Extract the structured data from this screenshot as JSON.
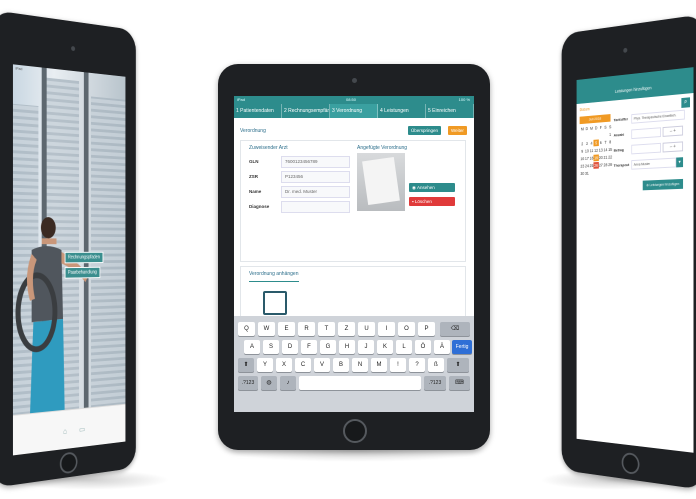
{
  "left_tablet": {
    "status_time": "iPad",
    "overlay_buttons": [
      "Rechnungspfaden",
      "Paarbehandlung"
    ]
  },
  "center_tablet": {
    "status": {
      "left": "iPad",
      "time": "08:50",
      "right": "100 %"
    },
    "steps": [
      {
        "label": "1 Patientendaten",
        "active": false
      },
      {
        "label": "2 Rechnungsempfänger",
        "active": false
      },
      {
        "label": "3 Verordnung",
        "active": true
      },
      {
        "label": "4 Leistungen",
        "active": false
      },
      {
        "label": "5 Einreichen",
        "active": false
      }
    ],
    "section_title": "Verordnung",
    "top_buttons": {
      "skip": "Überspringen",
      "next": "Weiter"
    },
    "card_title": "Zuweisender Arzt",
    "fields": [
      {
        "label": "GLN",
        "value": "7600123456789"
      },
      {
        "label": "ZSR",
        "value": "P123456"
      },
      {
        "label": "Name",
        "value": "Dr. med. Muster"
      },
      {
        "label": "Diagnose",
        "value": ""
      }
    ],
    "attachment_title": "Angefügte Verordnung",
    "view_button": "Ansehen",
    "delete_button": "Löschen",
    "attach_title": "Verordnung anhängen",
    "keyboard": {
      "row1": [
        "Q",
        "W",
        "E",
        "R",
        "T",
        "Z",
        "U",
        "I",
        "O",
        "P"
      ],
      "row2": [
        "A",
        "S",
        "D",
        "F",
        "G",
        "H",
        "J",
        "K",
        "L",
        "Ö",
        "Ä"
      ],
      "row3": [
        "Y",
        "X",
        "C",
        "V",
        "B",
        "N",
        "M",
        "!",
        "?",
        "ß"
      ],
      "row3_sub": [
        ",",
        "."
      ],
      "done": "Fertig",
      "num_left": ".?123",
      "num_right": ".?123"
    }
  },
  "right_tablet": {
    "header": "Leistungen hinzufügen",
    "sidebar_label": "Datum",
    "calendar_month": "Juli 2018",
    "weekdays": [
      "M",
      "D",
      "M",
      "D",
      "F",
      "S",
      "S"
    ],
    "days": [
      "1",
      "2",
      "3",
      "4",
      "5",
      "6",
      "7",
      "8",
      "9",
      "10",
      "11",
      "12",
      "13",
      "14",
      "15",
      "16",
      "17",
      "18",
      "19",
      "20",
      "21",
      "22",
      "23",
      "24",
      "25",
      "26",
      "27",
      "28",
      "29",
      "30",
      "31"
    ],
    "form": [
      {
        "label": "Tarifziffer",
        "value": "Phys. Therapeutische Einzelbeh."
      },
      {
        "label": "Anzahl",
        "value": ""
      },
      {
        "label": "Betrag",
        "value": ""
      },
      {
        "label": "Therapeut",
        "value": "Anna Muster"
      }
    ],
    "add_button": "Leistungen hinzufügen"
  }
}
